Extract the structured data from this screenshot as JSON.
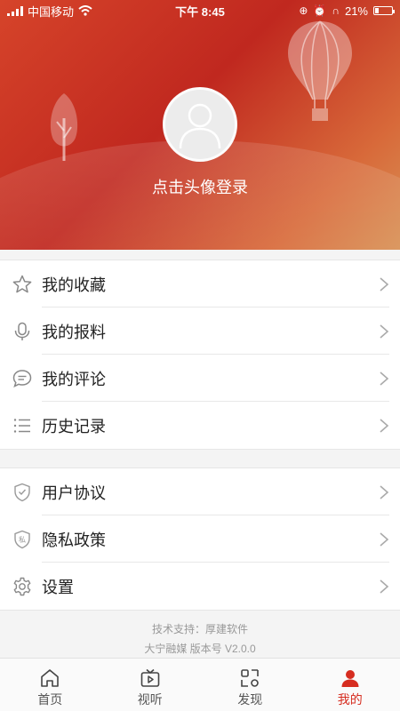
{
  "status": {
    "carrier": "中国移动",
    "time": "下午 8:45",
    "battery_text": "21%",
    "battery_level": 0.21
  },
  "profile": {
    "login_prompt": "点击头像登录"
  },
  "menu_group1": [
    {
      "label": "我的收藏",
      "icon": "star-icon"
    },
    {
      "label": "我的报料",
      "icon": "microphone-icon"
    },
    {
      "label": "我的评论",
      "icon": "comment-icon"
    },
    {
      "label": "历史记录",
      "icon": "list-icon"
    }
  ],
  "menu_group2": [
    {
      "label": "用户协议",
      "icon": "shield-check-icon"
    },
    {
      "label": "隐私政策",
      "icon": "shield-private-icon"
    },
    {
      "label": "设置",
      "icon": "gear-icon"
    }
  ],
  "footer": {
    "tech_support": "技术支持：厚建软件",
    "version": "大宁融媒  版本号 V2.0.0"
  },
  "tabs": [
    {
      "label": "首页",
      "icon": "home-icon"
    },
    {
      "label": "视听",
      "icon": "tv-icon"
    },
    {
      "label": "发现",
      "icon": "discover-icon"
    },
    {
      "label": "我的",
      "icon": "user-icon",
      "active": true
    }
  ],
  "colors": {
    "accent": "#d62d20",
    "header_start": "#c0281f",
    "header_end": "#d89155"
  }
}
